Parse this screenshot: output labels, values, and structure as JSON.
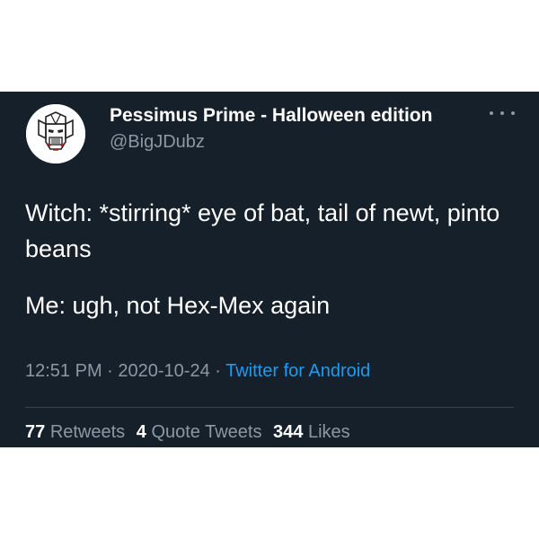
{
  "tweet": {
    "author": {
      "display_name": "Pessimus Prime - Halloween edition",
      "handle": "@BigJDubz",
      "avatar_icon": "robot-helmet-icon"
    },
    "more_icon": "more-options-icon",
    "text": {
      "line1": "Witch: *stirring* eye of bat, tail of newt, pinto beans",
      "line2": "Me: ugh, not Hex-Mex again"
    },
    "meta": {
      "time": "12:51 PM",
      "separator": " · ",
      "date": "2020-10-24",
      "source": "Twitter for Android"
    },
    "stats": {
      "retweets_count": "77",
      "retweets_label": "Retweets",
      "quotes_count": "4",
      "quotes_label": "Quote Tweets",
      "likes_count": "344",
      "likes_label": "Likes"
    }
  },
  "colors": {
    "card_background": "#15202b",
    "primary_text": "#ffffff",
    "secondary_text": "#8b98a5",
    "link": "#1d9bf0",
    "divider": "#38444d"
  }
}
